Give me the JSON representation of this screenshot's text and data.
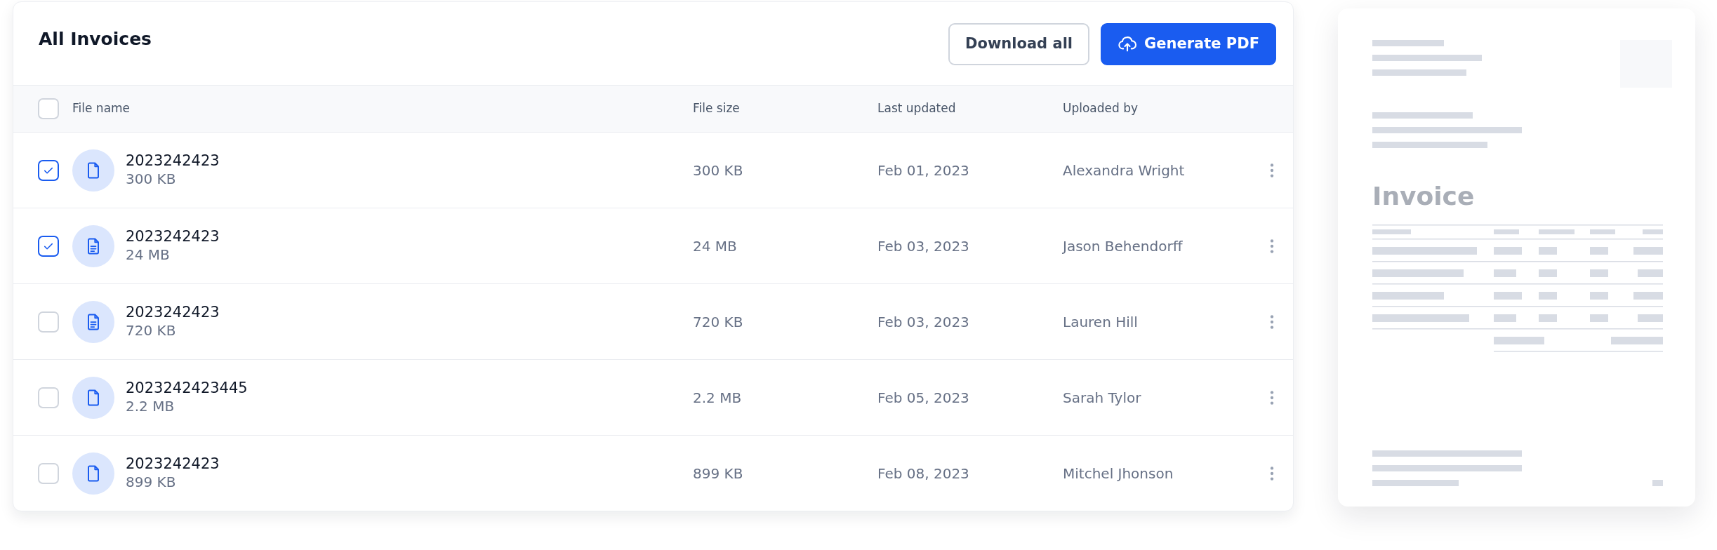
{
  "title": "All Invoices",
  "actions": [
    {
      "label": "Download all",
      "kind": "secondary"
    },
    {
      "label": "Generate PDF",
      "kind": "primary"
    }
  ],
  "table": {
    "header_checked": false,
    "columns": [
      "File name",
      "File size",
      "Last updated",
      "Uploaded by"
    ],
    "rows": [
      {
        "checked": true,
        "kind": "plain",
        "name": "2023242423",
        "subtitle": "300 KB",
        "file_size": "300 KB",
        "last_updated": "Feb 01, 2023",
        "uploaded_by": "Alexandra Wright"
      },
      {
        "checked": true,
        "kind": "text",
        "name": "2023242423",
        "subtitle": "24 MB",
        "file_size": "24 MB",
        "last_updated": "Feb 03, 2023",
        "uploaded_by": "Jason Behendorff"
      },
      {
        "checked": false,
        "kind": "text",
        "name": "2023242423",
        "subtitle": "720 KB",
        "file_size": "720 KB",
        "last_updated": "Feb 03, 2023",
        "uploaded_by": "Lauren Hill"
      },
      {
        "checked": false,
        "kind": "plain",
        "name": "2023242423445",
        "subtitle": "2.2 MB",
        "file_size": "2.2 MB",
        "last_updated": "Feb 05, 2023",
        "uploaded_by": "Sarah Tylor"
      },
      {
        "checked": false,
        "kind": "plain",
        "name": "2023242423",
        "subtitle": "899 KB",
        "file_size": "899 KB",
        "last_updated": "Feb 08, 2023",
        "uploaded_by": "Mitchel Jhonson"
      }
    ]
  },
  "preview": {
    "title": "Invoice"
  }
}
